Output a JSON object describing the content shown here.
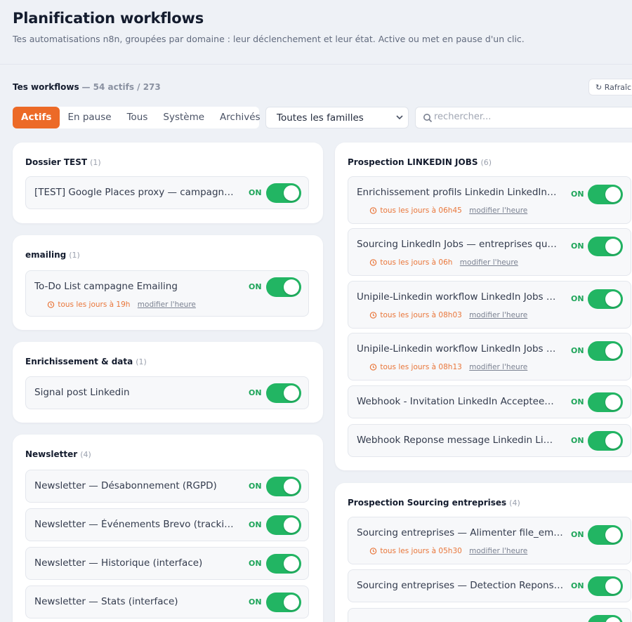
{
  "header": {
    "title": "Planification workflows",
    "subtitle": "Tes automatisations n8n, groupées par domaine : leur déclenchement et leur état. Active ou met en pause d'un clic."
  },
  "workflows_bar": {
    "title": "Tes workflows",
    "meta": "— 54 actifs / 273",
    "refresh_label": "↻ Rafraîchir"
  },
  "tabs": [
    {
      "label": "Actifs",
      "active": true
    },
    {
      "label": "En pause"
    },
    {
      "label": "Tous"
    },
    {
      "label": "Système"
    },
    {
      "label": "Archivés"
    }
  ],
  "family_select": {
    "value": "Toutes les familles"
  },
  "search": {
    "placeholder": "rechercher..."
  },
  "on_label": "ON",
  "edit_label": "modifier l'heure",
  "colors": {
    "accent": "#ec6a27",
    "toggle_on": "#22b563",
    "on_text": "#1fa55a",
    "schedule": "#e9763a"
  },
  "groups": {
    "dossier_test": {
      "name": "Dossier TEST",
      "count": "(1)",
      "items": [
        {
          "name": "[TEST] Google Places proxy — campagne e..."
        }
      ]
    },
    "emailing": {
      "name": "emailing",
      "count": "(1)",
      "items": [
        {
          "name": "To-Do List campagne Emailing",
          "schedule": "tous les jours à 19h"
        }
      ]
    },
    "enrichissement": {
      "name": "Enrichissement & data",
      "count": "(1)",
      "items": [
        {
          "name": "Signal post Linkedin"
        }
      ]
    },
    "newsletter": {
      "name": "Newsletter",
      "count": "(4)",
      "items": [
        {
          "name": "Newsletter — Désabonnement (RGPD)"
        },
        {
          "name": "Newsletter — Événements Brevo (tracking)"
        },
        {
          "name": "Newsletter — Historique (interface)"
        },
        {
          "name": "Newsletter — Stats (interface)"
        }
      ]
    },
    "linkedin_jobs": {
      "name": "Prospection LINKEDIN JOBS",
      "count": "(6)",
      "items": [
        {
          "name": "Enrichissement profils Linkedin LinkedIn Jo...",
          "schedule": "tous les jours à 06h45"
        },
        {
          "name": "Sourcing LinkedIn Jobs — entreprises qui re...",
          "schedule": "tous les jours à 06h"
        },
        {
          "name": "Unipile-Linkedin workflow LinkedIn Jobs V3...",
          "schedule": "tous les jours à 08h03"
        },
        {
          "name": "Unipile-Linkedin workflow LinkedIn Jobs V3...",
          "schedule": "tous les jours à 08h13"
        },
        {
          "name": "Webhook - Invitation LinkedIn Acceptee Li..."
        },
        {
          "name": "Webhook Reponse message Linkedin Link..."
        }
      ]
    },
    "sourcing_entreprises": {
      "name": "Prospection Sourcing entreprises",
      "count": "(4)",
      "items": [
        {
          "name": "Sourcing entreprises — Alimenter file_emails",
          "schedule": "tous les jours à 05h30"
        },
        {
          "name": "Sourcing entreprises — Detection Reponses"
        }
      ]
    }
  }
}
